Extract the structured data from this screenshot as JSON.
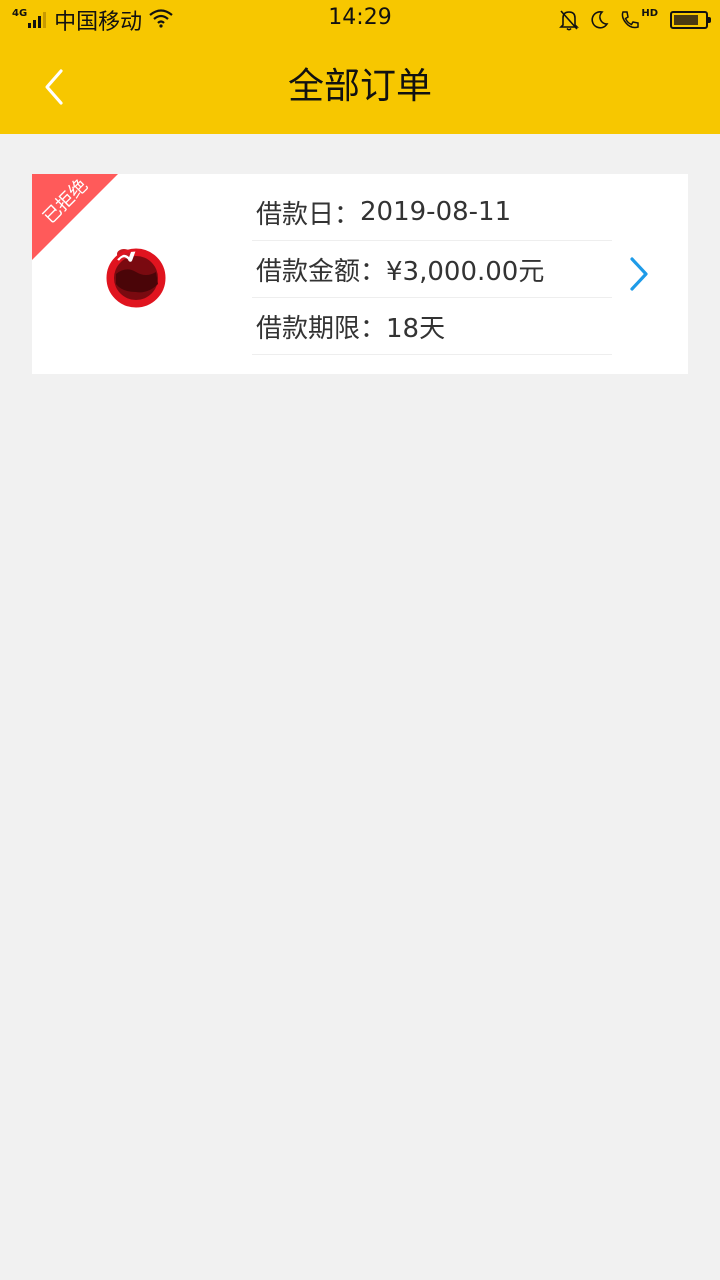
{
  "statusbar": {
    "network_type": "4G",
    "carrier": "中国移动",
    "time": "14:29",
    "hd_badge": "HD",
    "battery_level": 0.8,
    "icons": [
      "signal-icon",
      "wifi-icon",
      "mute-bell-icon",
      "moon-icon",
      "hd-call-icon",
      "battery-icon"
    ]
  },
  "navbar": {
    "back_icon": "chevron-left-icon",
    "title": "全部订单",
    "background_color": "#f7c700"
  },
  "orders": [
    {
      "status_badge": "已拒绝",
      "status_color": "#ff5a5a",
      "logo_icon": "lender-logo-icon",
      "rows": [
        {
          "label": "借款日：",
          "value": "2019-08-11"
        },
        {
          "label": "借款金额：",
          "value": "¥3,000.00元"
        },
        {
          "label": "借款期限：",
          "value": "18天"
        }
      ],
      "chevron_icon": "chevron-right-icon",
      "chevron_color": "#1e9be8"
    }
  ]
}
